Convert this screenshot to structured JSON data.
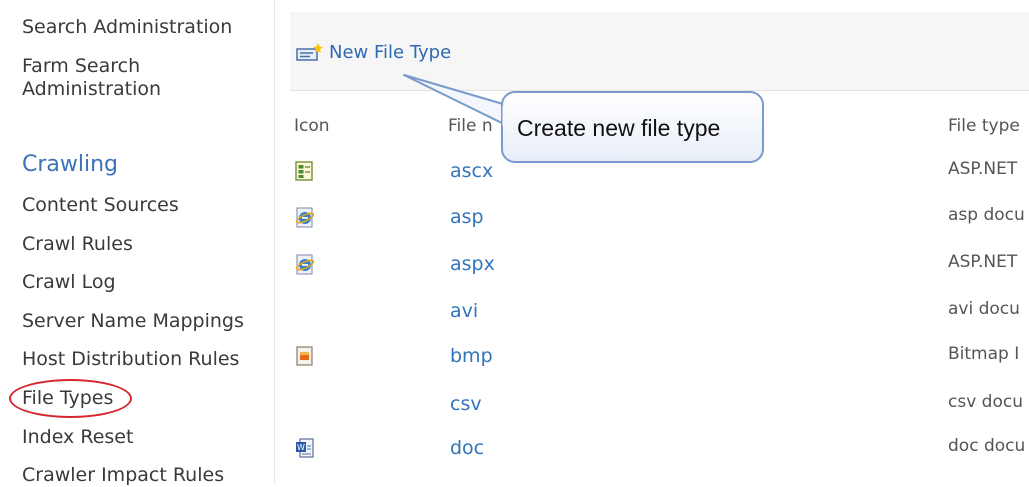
{
  "nav": {
    "items_top": [
      "Search Administration",
      "Farm Search Administration"
    ],
    "crawling_heading": "Crawling",
    "crawling_items": [
      "Content Sources",
      "Crawl Rules",
      "Crawl Log",
      "Server Name Mappings",
      "Host Distribution Rules",
      "File Types",
      "Index Reset",
      "Crawler Impact Rules"
    ]
  },
  "toolbar": {
    "new_file_type_label": "New File Type"
  },
  "table": {
    "headers": {
      "icon": "Icon",
      "name": "File n",
      "type": "File type"
    },
    "rows": [
      {
        "icon": "ascx-icon",
        "name": "ascx",
        "type": "ASP.NET"
      },
      {
        "icon": "ie-icon",
        "name": "asp",
        "type": "asp docu"
      },
      {
        "icon": "ie-icon",
        "name": "aspx",
        "type": "ASP.NET"
      },
      {
        "icon": "",
        "name": "avi",
        "type": "avi docu"
      },
      {
        "icon": "bitmap-icon",
        "name": "bmp",
        "type": "Bitmap I"
      },
      {
        "icon": "",
        "name": "csv",
        "type": "csv docu"
      },
      {
        "icon": "word-icon",
        "name": "doc",
        "type": "doc docu"
      }
    ]
  },
  "callout": {
    "text": "Create new file type"
  },
  "colors": {
    "link": "#3474b8",
    "heading": "#3b73b9",
    "highlight": "#d8262e",
    "callout_border": "#7a99cc"
  }
}
